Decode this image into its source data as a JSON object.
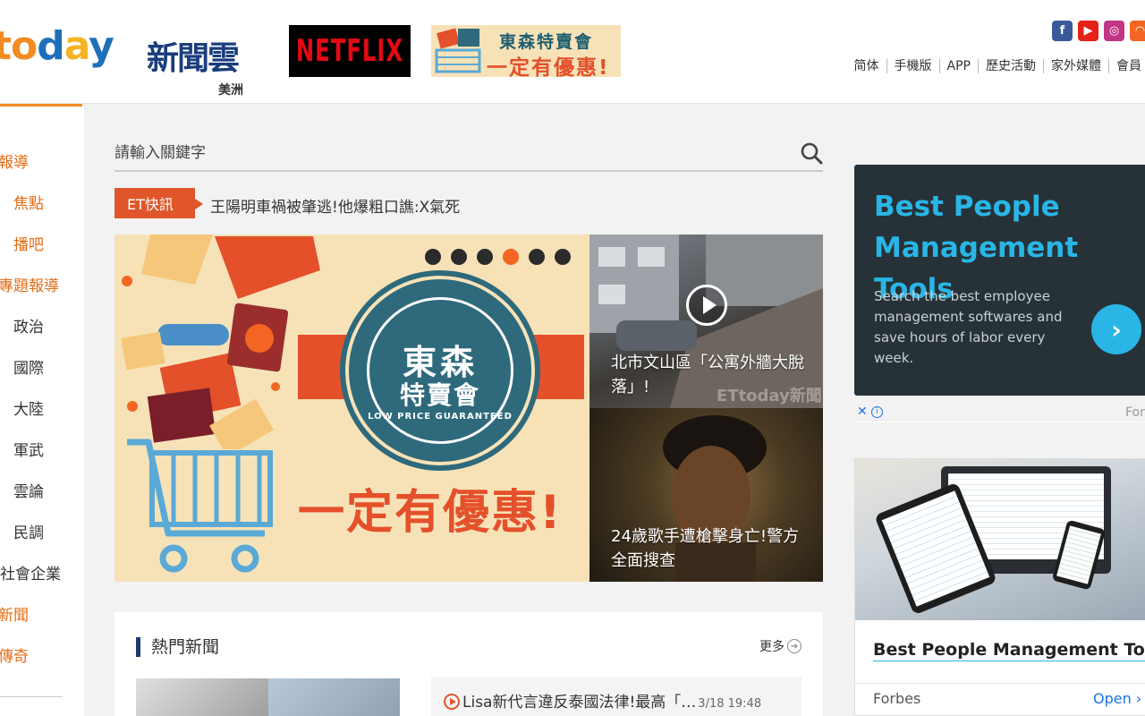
{
  "header": {
    "logo_text": "today",
    "logo_cn": "新聞雲",
    "region": "美洲",
    "netflix_label": "NETFLIX",
    "promo_line1": "東森特賣會",
    "promo_line2": "一定有優惠!",
    "social_icons": [
      "facebook-icon",
      "youtube-icon",
      "instagram-icon",
      "rss-icon"
    ],
    "nav": [
      "简体",
      "手機版",
      "APP",
      "歷史活動",
      "家外媒體",
      "會員"
    ]
  },
  "sidebar": {
    "items": [
      {
        "label": "報導",
        "color": "#e56c15"
      },
      {
        "label": "焦點",
        "color": "#e56c15"
      },
      {
        "label": "播吧",
        "color": "#e56c15"
      },
      {
        "label": "專題報導",
        "color": "#e56c15"
      },
      {
        "label": "政治",
        "color": "#333333"
      },
      {
        "label": "國際",
        "color": "#333333"
      },
      {
        "label": "大陸",
        "color": "#333333"
      },
      {
        "label": "軍武",
        "color": "#333333"
      },
      {
        "label": "雲論",
        "color": "#333333"
      },
      {
        "label": "民調",
        "color": "#333333"
      },
      {
        "label": "社會企業",
        "color": "#333333"
      },
      {
        "label": "新聞",
        "color": "#e56c15"
      },
      {
        "label": "傳奇",
        "color": "#e56c15"
      }
    ]
  },
  "search": {
    "placeholder": "請輸入關鍵字"
  },
  "flash": {
    "tag": "ET快訊",
    "headline": "王陽明車禍被肇逃!他爆粗口譙:X氣死"
  },
  "banner": {
    "slide_count": 6,
    "active_slide": 4,
    "seal_title": "東森",
    "seal_subtitle": "特賣會",
    "seal_english": "LOW PRICE GUARANTEED",
    "slogan": "一定有優惠!"
  },
  "side_news": [
    {
      "caption": "北市文山區「公寓外牆大脫落」!",
      "has_video": true,
      "watermark": "ETtoday新聞"
    },
    {
      "caption": "24歲歌手遭槍擊身亡!警方全面搜查",
      "has_video": false
    }
  ],
  "hot_news": {
    "title": "熱門新聞",
    "more_label": "更多",
    "items": [
      {
        "headline": "Lisa新代言違反泰國法律!最高「…",
        "time": "3/18 19:48"
      }
    ]
  },
  "ads": {
    "ad1": {
      "headline": "Best People Management Tools",
      "body": "Search the best employee management softwares and save hours of labor every week.",
      "button_icon": "chevron-right-icon",
      "label_right": "For"
    },
    "ad2": {
      "title": "Best People Management Tools",
      "source": "Forbes",
      "cta": "Open"
    }
  }
}
